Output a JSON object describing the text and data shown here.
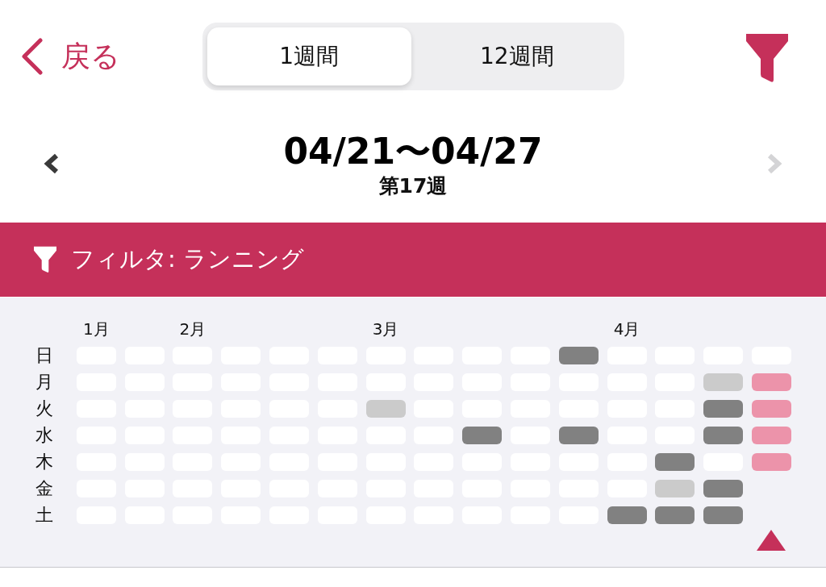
{
  "header": {
    "back_label": "戻る",
    "tabs": [
      {
        "label": "1週間",
        "selected": true
      },
      {
        "label": "12週間",
        "selected": false
      }
    ]
  },
  "week_nav": {
    "title": "04/21〜04/27",
    "subtitle": "第17週",
    "prev_disabled": false,
    "next_disabled": true
  },
  "filter_banner": {
    "label": "フィルタ: ランニング"
  },
  "heatmap": {
    "day_labels": [
      "日",
      "月",
      "火",
      "水",
      "木",
      "金",
      "土"
    ],
    "weeks": [
      {
        "month": "1月",
        "selected": false,
        "days": [
          {
            "kind": "none"
          },
          {
            "kind": "none"
          },
          {
            "kind": "none"
          },
          {
            "kind": "none"
          },
          {
            "kind": "none"
          },
          {
            "kind": "none"
          },
          {
            "kind": "none"
          }
        ]
      },
      {
        "selected": false,
        "days": [
          {
            "kind": "none"
          },
          {
            "kind": "none"
          },
          {
            "kind": "none"
          },
          {
            "kind": "none"
          },
          {
            "kind": "none"
          },
          {
            "kind": "none"
          },
          {
            "kind": "none"
          }
        ]
      },
      {
        "month": "2月",
        "selected": false,
        "days": [
          {
            "kind": "none"
          },
          {
            "kind": "none"
          },
          {
            "kind": "none"
          },
          {
            "kind": "none"
          },
          {
            "kind": "none"
          },
          {
            "kind": "none"
          },
          {
            "kind": "none"
          }
        ]
      },
      {
        "selected": false,
        "days": [
          {
            "kind": "none"
          },
          {
            "kind": "none"
          },
          {
            "kind": "none"
          },
          {
            "kind": "none"
          },
          {
            "kind": "none"
          },
          {
            "kind": "none"
          },
          {
            "kind": "none"
          }
        ]
      },
      {
        "selected": false,
        "days": [
          {
            "kind": "none"
          },
          {
            "kind": "none"
          },
          {
            "kind": "none"
          },
          {
            "kind": "none"
          },
          {
            "kind": "none"
          },
          {
            "kind": "none"
          },
          {
            "kind": "none"
          }
        ]
      },
      {
        "selected": false,
        "days": [
          {
            "kind": "none"
          },
          {
            "kind": "none"
          },
          {
            "kind": "none"
          },
          {
            "kind": "none"
          },
          {
            "kind": "none"
          },
          {
            "kind": "none"
          },
          {
            "kind": "none"
          }
        ]
      },
      {
        "month": "3月",
        "selected": false,
        "days": [
          {
            "kind": "none"
          },
          {
            "kind": "none"
          },
          {
            "kind": "light"
          },
          {
            "kind": "none"
          },
          {
            "kind": "none"
          },
          {
            "kind": "none"
          },
          {
            "kind": "none"
          }
        ]
      },
      {
        "selected": false,
        "days": [
          {
            "kind": "none"
          },
          {
            "kind": "none"
          },
          {
            "kind": "none"
          },
          {
            "kind": "none"
          },
          {
            "kind": "none"
          },
          {
            "kind": "none"
          },
          {
            "kind": "none"
          }
        ]
      },
      {
        "selected": false,
        "days": [
          {
            "kind": "none"
          },
          {
            "kind": "none"
          },
          {
            "kind": "none"
          },
          {
            "kind": "dark"
          },
          {
            "kind": "none"
          },
          {
            "kind": "none"
          },
          {
            "kind": "none"
          }
        ]
      },
      {
        "selected": false,
        "days": [
          {
            "kind": "none"
          },
          {
            "kind": "none"
          },
          {
            "kind": "none"
          },
          {
            "kind": "none"
          },
          {
            "kind": "none"
          },
          {
            "kind": "none"
          },
          {
            "kind": "none"
          }
        ]
      },
      {
        "selected": false,
        "days": [
          {
            "kind": "dark"
          },
          {
            "kind": "none"
          },
          {
            "kind": "none"
          },
          {
            "kind": "dark"
          },
          {
            "kind": "none"
          },
          {
            "kind": "none"
          },
          {
            "kind": "none"
          }
        ]
      },
      {
        "month": "4月",
        "selected": false,
        "days": [
          {
            "kind": "none"
          },
          {
            "kind": "none"
          },
          {
            "kind": "none"
          },
          {
            "kind": "none"
          },
          {
            "kind": "none"
          },
          {
            "kind": "none"
          },
          {
            "kind": "dark"
          }
        ]
      },
      {
        "selected": false,
        "days": [
          {
            "kind": "none"
          },
          {
            "kind": "none"
          },
          {
            "kind": "none"
          },
          {
            "kind": "none"
          },
          {
            "kind": "dark"
          },
          {
            "kind": "light"
          },
          {
            "kind": "dark"
          }
        ]
      },
      {
        "selected": false,
        "days": [
          {
            "kind": "none"
          },
          {
            "kind": "light"
          },
          {
            "kind": "dark"
          },
          {
            "kind": "dark"
          },
          {
            "kind": "none"
          },
          {
            "kind": "dark"
          },
          {
            "kind": "dark"
          }
        ]
      },
      {
        "selected": true,
        "days": [
          {
            "kind": "none"
          },
          {
            "kind": "accent"
          },
          {
            "kind": "accent"
          },
          {
            "kind": "accent"
          },
          {
            "kind": "accent"
          }
        ]
      }
    ]
  }
}
